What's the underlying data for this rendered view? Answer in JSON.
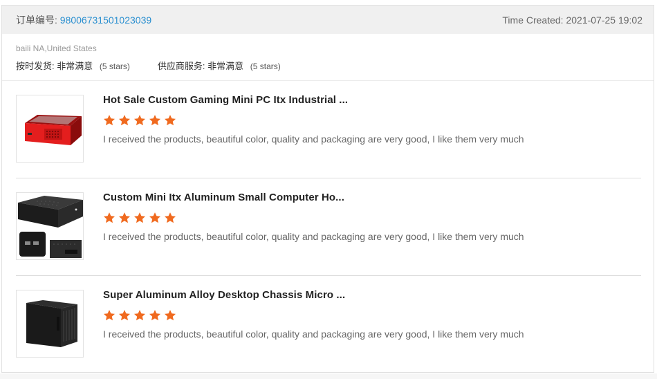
{
  "order": {
    "number_label": "订单编号:",
    "number": "98006731501023039",
    "time_created": "Time Created: 2021-07-25 19:02"
  },
  "seller": {
    "location": "baili NA,United States",
    "ratings": [
      {
        "label": "按时发货:",
        "value": "非常满意",
        "stars_text": "(5 stars)"
      },
      {
        "label": "供应商服务:",
        "value": "非常满意",
        "stars_text": "(5 stars)"
      }
    ]
  },
  "items": [
    {
      "title": "Hot Sale Custom Gaming Mini PC Itx Industrial ...",
      "rating": 5,
      "review": "I received the products, beautiful color, quality and packaging are very good, I like them very much"
    },
    {
      "title": "Custom Mini Itx Aluminum Small Computer Ho...",
      "rating": 5,
      "review": "I received the products, beautiful color, quality and packaging are very good, I like them very much"
    },
    {
      "title": "Super Aluminum Alloy Desktop Chassis Micro ...",
      "rating": 5,
      "review": "I received the products, beautiful color, quality and packaging are very good, I like them very much"
    }
  ],
  "colors": {
    "star": "#f06a1f",
    "order_number": "#2a8fd0"
  }
}
